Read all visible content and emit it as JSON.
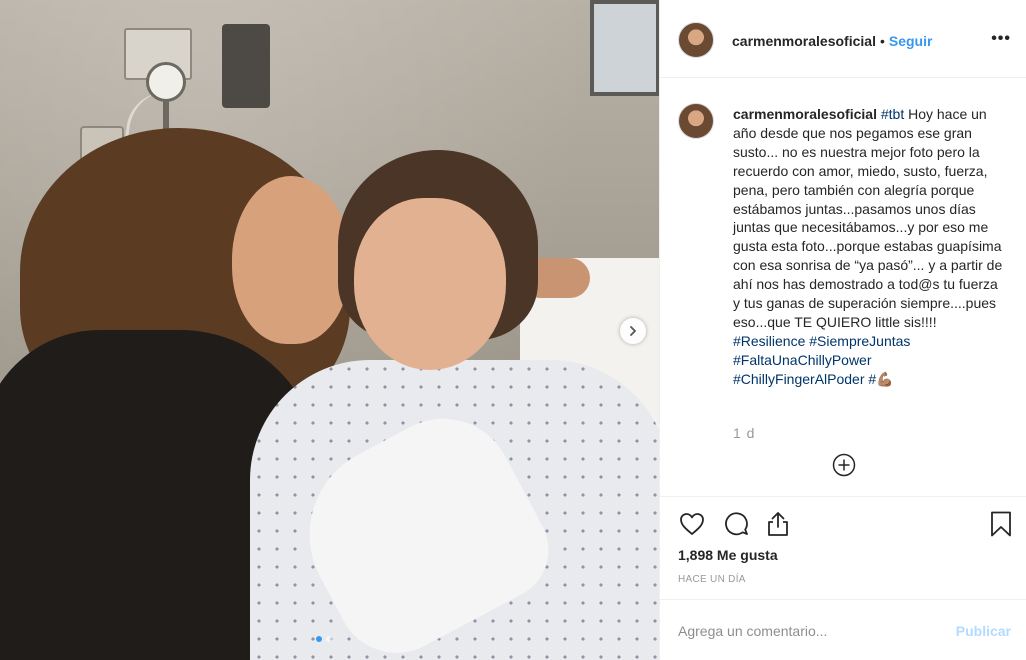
{
  "post": {
    "username": "carmenmoralesoficial",
    "separator": "•",
    "follow_label": "Seguir",
    "more_label": "•••",
    "caption_segments": [
      {
        "text": "#tbt",
        "hashtag": true
      },
      {
        "text": " Hoy hace un año desde que nos pegamos ese gran susto... no es nuestra mejor foto pero la recuerdo con amor, miedo, susto, fuerza, pena, pero también con alegría porque estábamos juntas...pasamos unos días juntas que necesitábamos...y por eso me gusta esta foto...porque estabas guapísima con esa sonrisa de “ya pasó”... y a partir de ahí nos has demostrado a tod@s tu fuerza y tus ganas de superación siempre....pues eso...que TE QUIERO little sis!!!! ",
        "hashtag": false
      },
      {
        "text": "#Resilience",
        "hashtag": true
      },
      {
        "text": " ",
        "hashtag": false
      },
      {
        "text": "#SiempreJuntas",
        "hashtag": true
      },
      {
        "text": " ",
        "hashtag": false
      },
      {
        "text": "#FaltaUnaChillyPower",
        "hashtag": true
      },
      {
        "text": " ",
        "hashtag": false
      },
      {
        "text": "#ChillyFingerAlPoder",
        "hashtag": true
      },
      {
        "text": " ",
        "hashtag": false
      },
      {
        "text": "#",
        "hashtag": true
      },
      {
        "text": "💪🏽",
        "hashtag": false
      }
    ],
    "time_ago": "1 d",
    "likes": "1,898 Me gusta",
    "posted": "HACE UN DÍA"
  },
  "comment": {
    "placeholder": "Agrega un comentario...",
    "publish_label": "Publicar"
  },
  "icons": {
    "like": "heart-icon",
    "comment": "comment-icon",
    "share": "share-icon",
    "save": "bookmark-icon",
    "load_more": "plus-circle-icon",
    "next": "chevron-right-icon"
  },
  "colors": {
    "link": "#3897f0",
    "hashtag": "#003569",
    "muted": "#999999",
    "publish_disabled": "#b3dbff"
  }
}
